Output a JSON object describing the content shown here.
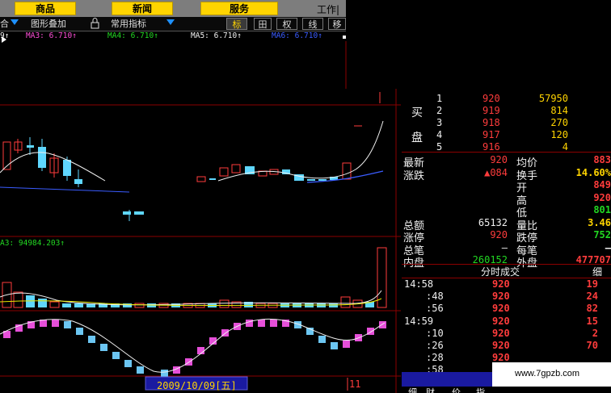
{
  "topbar": {
    "buttons": [
      "商品",
      "新闻",
      "服务"
    ],
    "work_menu": "工作|"
  },
  "toolbar": {
    "left_fragment": "合",
    "overlay_label": "图形叠加",
    "lock_icon": "lock-icon",
    "indicator_label": "常用指标",
    "buttons": [
      "标",
      "田",
      "权",
      "线",
      "移"
    ]
  },
  "ma_line": {
    "lead": "9↑",
    "ma3": "MA3: 6.710↑",
    "ma4": "MA4: 6.710↑",
    "ma5": "MA5: 6.710↑",
    "ma6": "MA6: 6.710↑"
  },
  "volume_label": "A3: 94984.203↑",
  "date_label": "2009/10/09[五]",
  "date_fragment": "11",
  "order_book": {
    "side_labels": [
      "买",
      "盘"
    ],
    "rows": [
      {
        "level": "1",
        "price": "920",
        "volume": "57950"
      },
      {
        "level": "2",
        "price": "919",
        "volume": "814"
      },
      {
        "level": "3",
        "price": "918",
        "volume": "270"
      },
      {
        "level": "4",
        "price": "917",
        "volume": "120"
      },
      {
        "level": "5",
        "price": "916",
        "volume": "4"
      }
    ]
  },
  "quote": {
    "rows": [
      {
        "l": "最新",
        "lv": "920",
        "r": "均价",
        "rv": "883"
      },
      {
        "l": "涨跌",
        "lv": "▲084",
        "r": "换手",
        "rv": "14.60%"
      },
      {
        "l": "",
        "lv": "",
        "r": "开",
        "rv": "849"
      },
      {
        "l": "",
        "lv": "",
        "r": "高",
        "rv": "920"
      },
      {
        "l": "",
        "lv": "",
        "r": "低",
        "rv": "801"
      },
      {
        "l": "总额",
        "lv": "65132",
        "r": "量比",
        "rv": "3.46"
      },
      {
        "l": "涨停",
        "lv": "920",
        "r": "跌停",
        "rv": "752"
      },
      {
        "l": "总笔",
        "lv": "–",
        "r": "每笔",
        "rv": "–"
      },
      {
        "l": "内盘",
        "lv": "260152",
        "r": "外盘",
        "rv": "477707"
      }
    ]
  },
  "trades": {
    "header": "分时成交",
    "header_right": "细",
    "rows": [
      {
        "time": "14:58",
        "price": "920",
        "vol": "19"
      },
      {
        "time": ":48",
        "price": "920",
        "vol": "24"
      },
      {
        "time": ":56",
        "price": "920",
        "vol": "82"
      },
      {
        "time": "14:59",
        "price": "920",
        "vol": "15"
      },
      {
        "time": ":10",
        "price": "920",
        "vol": "2"
      },
      {
        "time": ":26",
        "price": "920",
        "vol": "70"
      },
      {
        "time": ":28",
        "price": "920",
        "vol": ""
      },
      {
        "time": ":58",
        "price": "",
        "vol": ""
      }
    ],
    "bottom_tabs": [
      "细",
      "财",
      "价",
      "指"
    ]
  },
  "watermark": "www.7gpzb.com",
  "colors": {
    "up": "#ff3c3c",
    "down": "#5fd7ff",
    "menu": "#ffd400",
    "kdj_up": "#e64fd9",
    "kdj_down": "#6cc6f2"
  }
}
